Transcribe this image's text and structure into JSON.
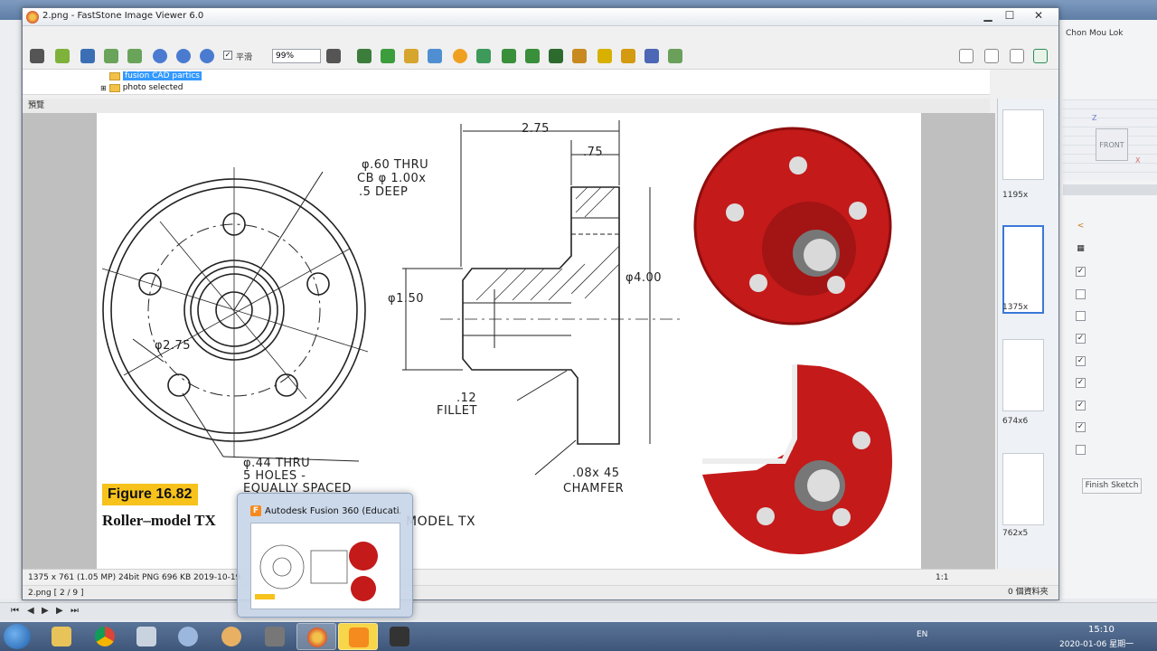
{
  "background": {
    "user_name": "Chon Mou Lok",
    "viewcube_label": "FRONT",
    "axis_z": "Z",
    "axis_x": "X",
    "finish_sketch_label": "Finish Sketch",
    "checkbox_states": [
      false,
      true,
      false,
      false,
      true,
      true,
      true,
      true,
      true,
      false
    ]
  },
  "window": {
    "title": "2.png  -  FastStone Image Viewer 6.0",
    "minimize": "▁",
    "maximize": "☐",
    "close": "✕"
  },
  "toolbar": {
    "smooth_label": "平滑",
    "smooth_checked": true,
    "zoom_value": "99%"
  },
  "tree": {
    "item1": "fusion CAD partics",
    "item2": "photo selected"
  },
  "preview_label": "預覽",
  "drawing": {
    "fig_number": "Figure 16.82",
    "caption": "Roller–model TX",
    "labels": {
      "dim_275_top": "2.75",
      "dim_75": ".75",
      "hole_note1": "φ.60 THRU",
      "hole_note2": "CB φ 1.00x",
      "hole_note3": ".5 DEEP",
      "dia_150": "φ1.50",
      "dia_400": "φ4.00",
      "bolt_circle": "φ2.75",
      "fillet1": ".12",
      "fillet2": "FILLET",
      "chamfer1": ".08x 45",
      "chamfer2": "CHAMFER",
      "thru1": "φ.44 THRU",
      "thru2": "5 HOLES -",
      "thru3": "EQUALLY SPACED",
      "model_partial": "MODEL TX"
    },
    "colors": {
      "part_red": "#c41a1a",
      "part_dark": "#8e0e0e",
      "badge_yellow": "#f6c21b"
    }
  },
  "thumbnails": [
    {
      "label": "1195x"
    },
    {
      "label": "1375x"
    },
    {
      "label": "674x6"
    },
    {
      "label": "762x5"
    }
  ],
  "status": {
    "info": "1375 x 761 (1.05 MP)  24bit  PNG   696 KB   2019-10-19",
    "ratio": "1:1",
    "file_index": "2.png [ 2 / 9 ]",
    "right": "0 個資料夾"
  },
  "popup": {
    "title": "Autodesk Fusion 360 (Educati..."
  },
  "tray": {
    "lang": "EN",
    "time": "15:10",
    "date": "2020-01-06 星期一"
  }
}
